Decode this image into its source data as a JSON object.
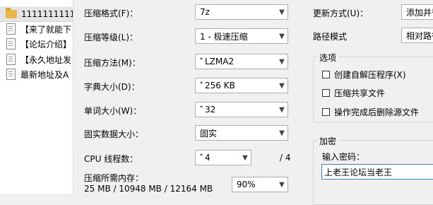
{
  "file_list": {
    "items": [
      {
        "icon": "folder-icon",
        "label": "1111111111",
        "selected": true
      },
      {
        "icon": "document-icon",
        "label": "【来了就能下"
      },
      {
        "icon": "document-icon",
        "label": "【论坛介绍】"
      },
      {
        "icon": "document-icon",
        "label": "【永久地址发"
      },
      {
        "icon": "document-icon",
        "label": "最新地址及A"
      }
    ]
  },
  "settings": {
    "format_label": "压缩格式(F)：",
    "format_value": "7z",
    "level_label": "压缩等级(L)：",
    "level_value": "1 - 极速压缩",
    "method_label": "压缩方法(M)：",
    "method_value": "LZMA2",
    "dict_label": "字典大小(D)：",
    "dict_value": "256 KB",
    "word_label": "单词大小(W)：",
    "word_value": "32",
    "solid_label": "固实数据大小：",
    "solid_value": "固实",
    "cpu_label": "CPU 线程数：",
    "cpu_value": "4",
    "cpu_total": "/ 4",
    "memory_label": "压缩所需内存：",
    "memory_value": "25 MB / 10948 MB / 12164 MB",
    "memory_percent": "90%"
  },
  "right_panel": {
    "update_label": "更新方式(U)：",
    "update_value": "添加并替换文件",
    "path_label": "路径模式",
    "path_value": "相对路径",
    "options_title": "选项",
    "option_sfx": "创建自解压程序(X)",
    "option_shared": "压缩共享文件",
    "option_delete": "操作完成后删除源文件",
    "encrypt_title": "加密",
    "password_label": "输入密码：",
    "password_value": "上老王论坛当老王"
  }
}
